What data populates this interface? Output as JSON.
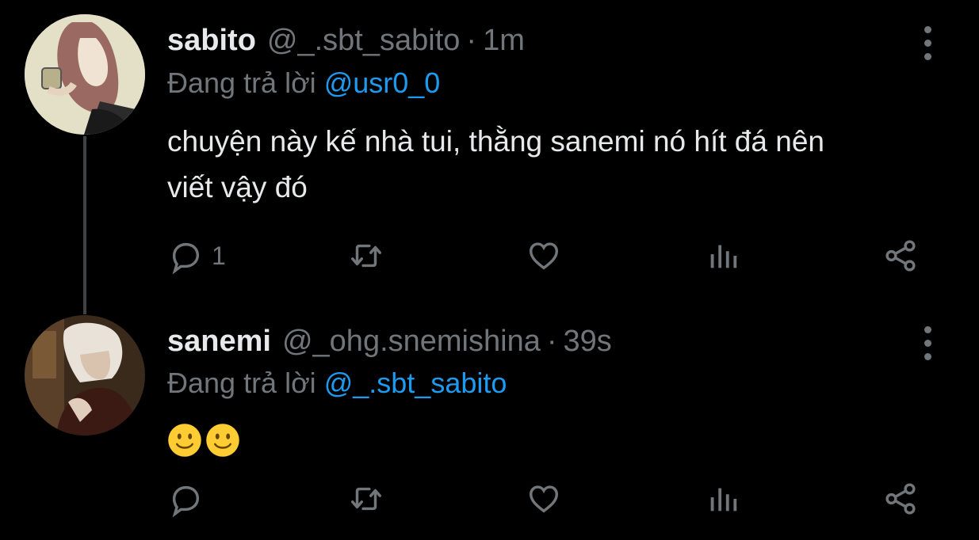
{
  "tweets": [
    {
      "name": "sabito",
      "handle": "@_.sbt_sabito",
      "separator": "·",
      "time": "1m",
      "reply_prefix": "Đang trả lời",
      "reply_to": "@usr0_0",
      "text_line1": "chuyện này kế nhà tui, thằng sanemi nó hít đá nên",
      "text_line2": "viết vậy đó",
      "reply_count": "1"
    },
    {
      "name": "sanemi",
      "handle": "@_ohg.snemishina",
      "separator": "·",
      "time": "39s",
      "reply_prefix": "Đang trả lời",
      "reply_to": "@_.sbt_sabito",
      "emojis": [
        "slightly-smiling-face-icon",
        "slightly-smiling-face-icon"
      ]
    }
  ],
  "colors": {
    "background": "#000000",
    "text": "#e7e9ea",
    "muted": "#71767b",
    "link": "#1d9bf0",
    "thread_line": "#3d4247"
  },
  "icons": [
    "reply-icon",
    "retweet-icon",
    "like-icon",
    "views-icon",
    "share-icon",
    "more-icon"
  ]
}
